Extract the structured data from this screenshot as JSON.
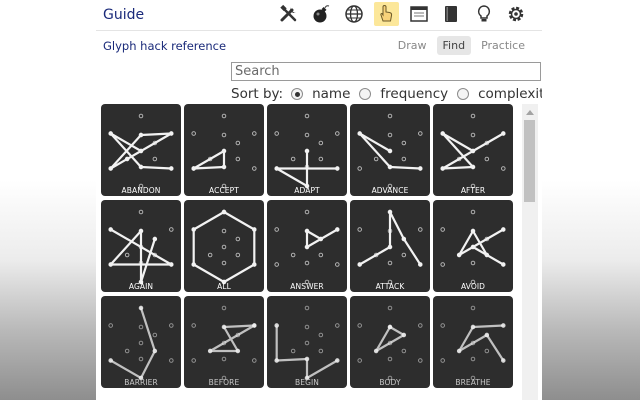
{
  "app": {
    "title": "Guide",
    "subtitle": "Glyph hack reference"
  },
  "toolbar": [
    {
      "icon": "tools-icon",
      "active": false
    },
    {
      "icon": "bomb-icon",
      "active": false
    },
    {
      "icon": "globe-icon",
      "active": false
    },
    {
      "icon": "hand-pointer-icon",
      "active": true
    },
    {
      "icon": "window-icon",
      "active": false
    },
    {
      "icon": "book-icon",
      "active": false
    },
    {
      "icon": "lightbulb-icon",
      "active": false
    },
    {
      "icon": "gear-icon",
      "active": false
    }
  ],
  "modes": [
    {
      "label": "Draw",
      "active": false
    },
    {
      "label": "Find",
      "active": true
    },
    {
      "label": "Practice",
      "active": false
    }
  ],
  "search": {
    "placeholder": "Search",
    "value": ""
  },
  "sort": {
    "label": "Sort by:",
    "options": [
      {
        "label": "name",
        "checked": true
      },
      {
        "label": "frequency",
        "checked": false
      },
      {
        "label": "complexity",
        "checked": false
      }
    ]
  },
  "glyphs": [
    {
      "name": "ABANDON",
      "path": [
        2,
        9,
        5,
        10,
        4,
        6,
        1,
        11
      ]
    },
    {
      "name": "ACCEPT",
      "path": [
        4,
        10,
        9,
        4
      ]
    },
    {
      "name": "ADAPT",
      "path": [
        2,
        4,
        3,
        10
      ]
    },
    {
      "name": "ADVANCE",
      "path": [
        2,
        9,
        5,
        10
      ]
    },
    {
      "name": "AFTER",
      "path": [
        1,
        4,
        9,
        5,
        10
      ]
    },
    {
      "name": "AGAIN",
      "path": [
        5,
        2,
        4,
        6,
        3,
        7
      ]
    },
    {
      "name": "ALL",
      "path": [
        0,
        1,
        2,
        3,
        4,
        5,
        0
      ]
    },
    {
      "name": "ANSWER",
      "path": [
        1,
        10,
        6,
        7
      ]
    },
    {
      "name": "ATTACK",
      "path": [
        2,
        7,
        0,
        10,
        4
      ]
    },
    {
      "name": "AVOID",
      "path": [
        1,
        11,
        6,
        8,
        10,
        2
      ]
    },
    {
      "name": "BARRIER",
      "path": [
        0,
        8,
        3,
        4
      ]
    },
    {
      "name": "BEFORE",
      "path": [
        1,
        6,
        8,
        11,
        1
      ]
    },
    {
      "name": "BEGIN",
      "path": [
        5,
        4,
        9,
        3,
        2
      ]
    },
    {
      "name": "BODY",
      "path": [
        6,
        7,
        11,
        6
      ]
    },
    {
      "name": "BREATHE",
      "path": [
        1,
        6,
        11,
        7,
        2
      ]
    }
  ]
}
